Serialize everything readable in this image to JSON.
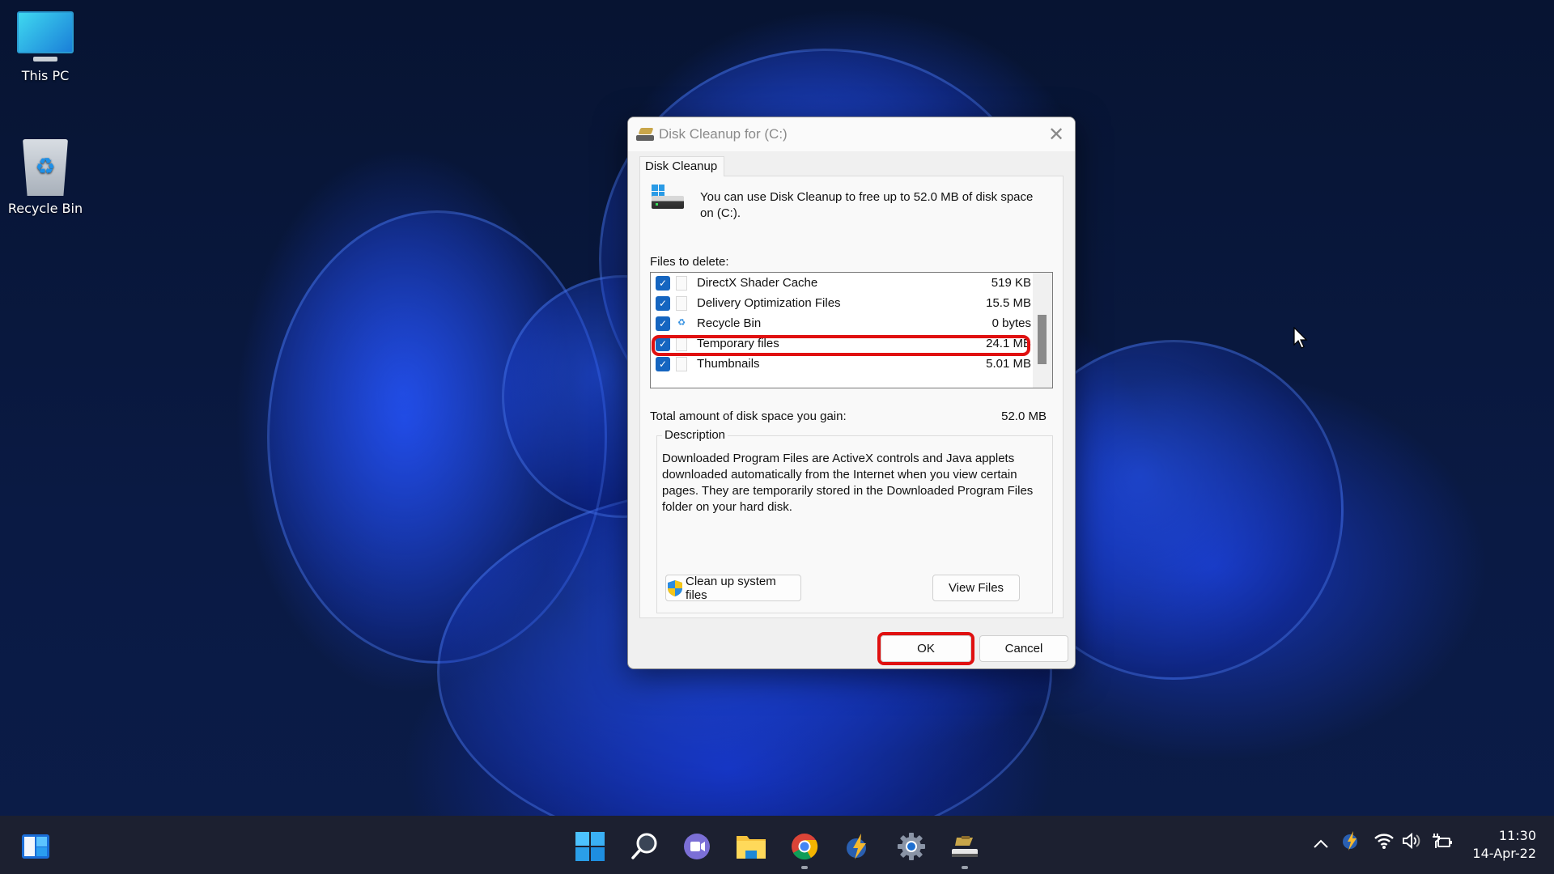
{
  "desktop": {
    "icons": [
      {
        "label": "This PC",
        "icon": "monitor-icon"
      },
      {
        "label": "Recycle Bin",
        "icon": "recycle-bin-icon"
      }
    ]
  },
  "dialog": {
    "title": "Disk Cleanup for  (C:)",
    "close_glyph": "✕",
    "tab_label": "Disk Cleanup",
    "intro_text": "You can use Disk Cleanup to free up to 52.0 MB of disk space on  (C:).",
    "files_label": "Files to delete:",
    "files": [
      {
        "name": "DirectX Shader Cache",
        "size": "519 KB",
        "checked": true,
        "icon": "file-icon"
      },
      {
        "name": "Delivery Optimization Files",
        "size": "15.5 MB",
        "checked": true,
        "icon": "file-icon"
      },
      {
        "name": "Recycle Bin",
        "size": "0 bytes",
        "checked": true,
        "icon": "recycle-icon"
      },
      {
        "name": "Temporary files",
        "size": "24.1 MB",
        "checked": true,
        "icon": "file-icon",
        "highlighted": true
      },
      {
        "name": "Thumbnails",
        "size": "5.01 MB",
        "checked": true,
        "icon": "file-icon"
      }
    ],
    "check_glyph": "✓",
    "total_label": "Total amount of disk space you gain:",
    "total_value": "52.0 MB",
    "description_legend": "Description",
    "description_text": "Downloaded Program Files are ActiveX controls and Java applets downloaded automatically from the Internet when you view certain pages. They are temporarily stored in the Downloaded Program Files folder on your hard disk.",
    "buttons": {
      "cleanup_system": "Clean up system files",
      "view_files": "View Files",
      "ok": "OK",
      "cancel": "Cancel"
    },
    "highlight_color": "#e01010"
  },
  "taskbar": {
    "pinned": [
      "widgets",
      "start",
      "search",
      "teams-chat",
      "file-explorer",
      "chrome",
      "app-bolt",
      "settings",
      "disk-cleanup"
    ],
    "tray": {
      "chevron": "^",
      "clock_time": "11:30",
      "clock_date": "14-Apr-22"
    }
  }
}
